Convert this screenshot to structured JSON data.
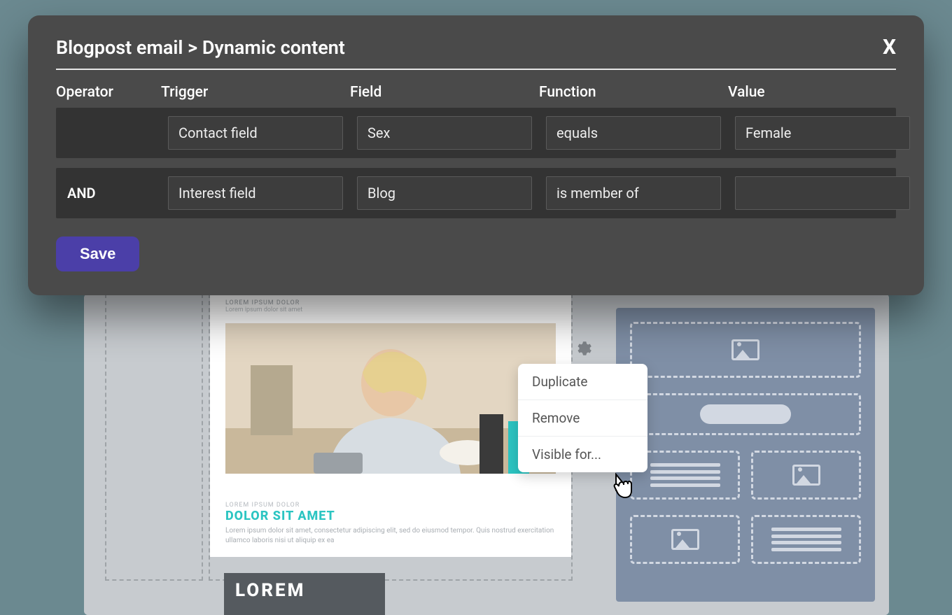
{
  "modal": {
    "title": "Blogpost email > Dynamic content",
    "close_label": "X",
    "headers": {
      "operator": "Operator",
      "trigger": "Trigger",
      "field": "Field",
      "function": "Function",
      "value": "Value"
    },
    "rows": [
      {
        "operator": "",
        "trigger": "Contact field",
        "field": "Sex",
        "function": "equals",
        "value": "Female"
      },
      {
        "operator": "AND",
        "trigger": "Interest field",
        "field": "Blog",
        "function": "is member of",
        "value": ""
      }
    ],
    "save_label": "Save"
  },
  "context_menu": {
    "items": [
      "Duplicate",
      "Remove",
      "Visible for..."
    ]
  },
  "editor_card": {
    "small_heading": "LOREM IPSUM DOLOR",
    "small_sub": "Lorem ipsum dolor sit amet",
    "caption_small": "LOREM IPSUM DOLOR",
    "caption_title": "DOLOR SIT AMET",
    "caption_body": "Lorem ipsum dolor sit amet, consectetur adipiscing elit, sed do eiusmod tempor. Quis nostrud exercitation ullamco laboris nisi ut aliquip ex ea",
    "lorem_block": "LOREM"
  }
}
